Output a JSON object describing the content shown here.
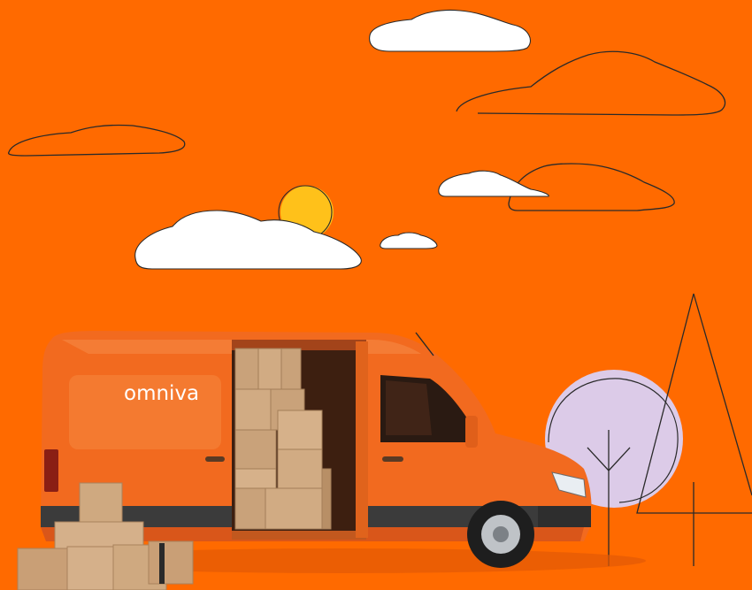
{
  "scene": {
    "background_color": "#ff6a00",
    "van_color": "#f26a1f",
    "van_shadow": "#d9561a",
    "sun_color": "#ffc11a",
    "tree_circle_color": "#dccbe8",
    "box_color": "#cfa980",
    "box_shadow": "#b78d63"
  },
  "van": {
    "logo_text": "omniva"
  }
}
